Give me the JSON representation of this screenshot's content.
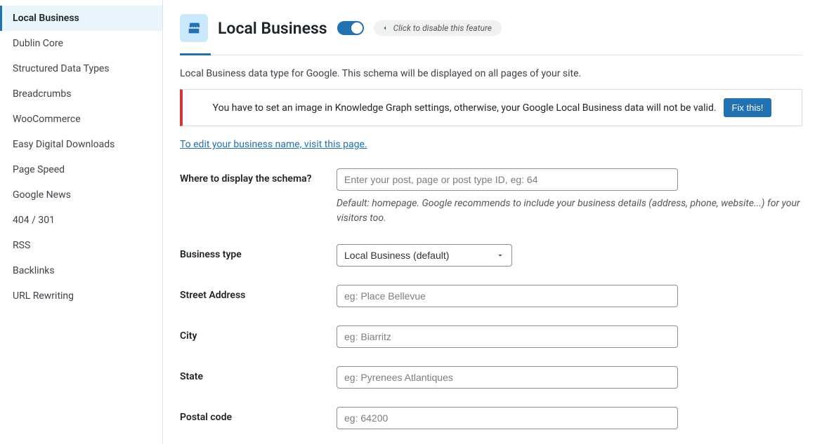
{
  "sidebar": {
    "items": [
      {
        "label": "Local Business",
        "active": true
      },
      {
        "label": "Dublin Core"
      },
      {
        "label": "Structured Data Types"
      },
      {
        "label": "Breadcrumbs"
      },
      {
        "label": "WooCommerce"
      },
      {
        "label": "Easy Digital Downloads"
      },
      {
        "label": "Page Speed"
      },
      {
        "label": "Google News"
      },
      {
        "label": "404 / 301"
      },
      {
        "label": "RSS"
      },
      {
        "label": "Backlinks"
      },
      {
        "label": "URL Rewriting"
      }
    ]
  },
  "header": {
    "title": "Local Business",
    "disable_text": "Click to disable this feature"
  },
  "intro": "Local Business data type for Google. This schema will be displayed on all pages of your site.",
  "alert": {
    "text": "You have to set an image in Knowledge Graph settings, otherwise, your Google Local Business data will not be valid.",
    "button": "Fix this!"
  },
  "edit_link": "To edit your business name, visit this page.",
  "fields": {
    "where": {
      "label": "Where to display the schema?",
      "placeholder": "Enter your post, page or post type ID, eg: 64",
      "hint": "Default: homepage. Google recommends to include your business details (address, phone, website...) for your visitors too."
    },
    "business_type": {
      "label": "Business type",
      "selected": "Local Business (default)"
    },
    "street": {
      "label": "Street Address",
      "placeholder": "eg: Place Bellevue"
    },
    "city": {
      "label": "City",
      "placeholder": "eg: Biarritz"
    },
    "state": {
      "label": "State",
      "placeholder": "eg: Pyrenees Atlantiques"
    },
    "postal": {
      "label": "Postal code",
      "placeholder": "eg: 64200"
    }
  }
}
